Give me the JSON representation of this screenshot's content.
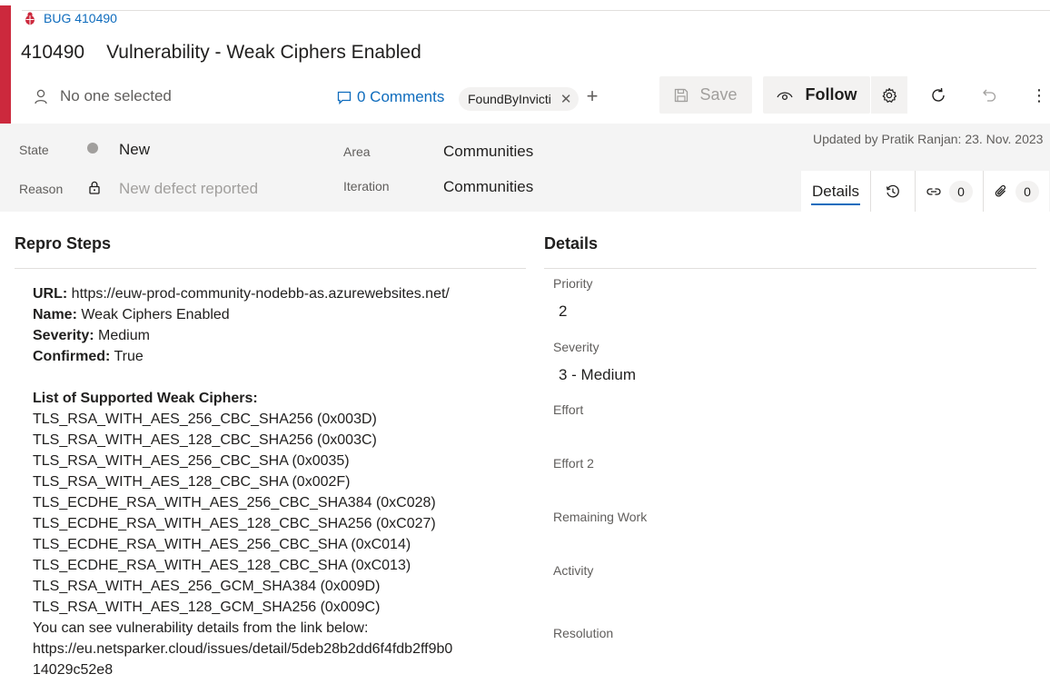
{
  "header": {
    "work_item_type": "BUG 410490",
    "id": "410490",
    "title": "Vulnerability - Weak Ciphers Enabled",
    "assignee": "No one selected",
    "comments": "0 Comments",
    "tag": "FoundByInvicti",
    "buttons": {
      "save": "Save",
      "follow": "Follow"
    },
    "accent_color": "#cc293d"
  },
  "fields": {
    "state_label": "State",
    "state_value": "New",
    "reason_label": "Reason",
    "reason_value": "New defect reported",
    "area_label": "Area",
    "area_value": "Communities",
    "iteration_label": "Iteration",
    "iteration_value": "Communities",
    "updated": "Updated by Pratik Ranjan: 23. Nov. 2023"
  },
  "tabs": {
    "details": "Details",
    "links_count": "0",
    "attachments_count": "0"
  },
  "repro": {
    "title": "Repro Steps",
    "url_label": "URL:",
    "url_value": " https://euw-prod-community-nodebb-as.azurewebsites.net/",
    "name_label": "Name:",
    "name_value": " Weak Ciphers Enabled",
    "severity_label": "Severity:",
    "severity_value": " Medium",
    "confirmed_label": "Confirmed:",
    "confirmed_value": " True",
    "list_title": "List of Supported Weak Ciphers:",
    "ciphers": [
      "TLS_RSA_WITH_AES_256_CBC_SHA256 (0x003D)",
      "TLS_RSA_WITH_AES_128_CBC_SHA256 (0x003C)",
      "TLS_RSA_WITH_AES_256_CBC_SHA (0x0035)",
      "TLS_RSA_WITH_AES_128_CBC_SHA (0x002F)",
      "TLS_ECDHE_RSA_WITH_AES_256_CBC_SHA384 (0xC028)",
      "TLS_ECDHE_RSA_WITH_AES_128_CBC_SHA256 (0xC027)",
      "TLS_ECDHE_RSA_WITH_AES_256_CBC_SHA (0xC014)",
      "TLS_ECDHE_RSA_WITH_AES_128_CBC_SHA (0xC013)",
      "TLS_RSA_WITH_AES_256_GCM_SHA384 (0x009D)",
      "TLS_RSA_WITH_AES_128_GCM_SHA256 (0x009C)"
    ],
    "link_intro": "You can see vulnerability details from the link below:",
    "link_line1": "https://eu.netsparker.cloud/issues/detail/5deb28b2dd6f4fdb2ff9b0",
    "link_line2": "14029c52e8"
  },
  "details": {
    "title": "Details",
    "priority_label": "Priority",
    "priority_value": "2",
    "severity_label": "Severity",
    "severity_value": "3 - Medium",
    "effort_label": "Effort",
    "effort2_label": "Effort 2",
    "remaining_label": "Remaining Work",
    "activity_label": "Activity",
    "resolution_label": "Resolution"
  }
}
